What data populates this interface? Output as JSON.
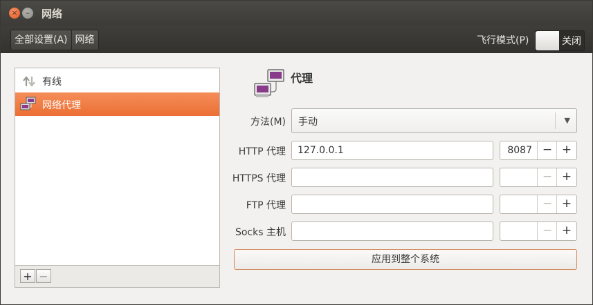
{
  "window": {
    "title": "网络",
    "close_glyph": "×",
    "minimize_glyph": "–"
  },
  "toolbar": {
    "breadcrumbs": [
      {
        "label": "全部设置(A)"
      },
      {
        "label": "网络"
      }
    ],
    "airplane_label": "飞行模式(P)",
    "airplane_state": "关闭"
  },
  "sidebar": {
    "items": [
      {
        "label": "有线",
        "icon": "wired-network-icon",
        "selected": false
      },
      {
        "label": "网络代理",
        "icon": "network-proxy-icon",
        "selected": true
      }
    ],
    "add_glyph": "+",
    "remove_glyph": "−"
  },
  "proxy": {
    "title": "代理",
    "method_label": "方法(M)",
    "method_value": "手动",
    "http_label": "HTTP 代理",
    "http_host": "127.0.0.1",
    "http_port": "8087",
    "https_label": "HTTPS 代理",
    "https_host": "",
    "https_port": "",
    "ftp_label": "FTP 代理",
    "ftp_host": "",
    "ftp_port": "",
    "socks_label": "Socks 主机",
    "socks_host": "",
    "socks_port": "",
    "minus_glyph": "−",
    "plus_glyph": "+",
    "apply_label": "应用到整个系统"
  },
  "colors": {
    "accent": "#eb6f33",
    "titlebar": "#3c3b37",
    "close_button": "#e2541b"
  }
}
